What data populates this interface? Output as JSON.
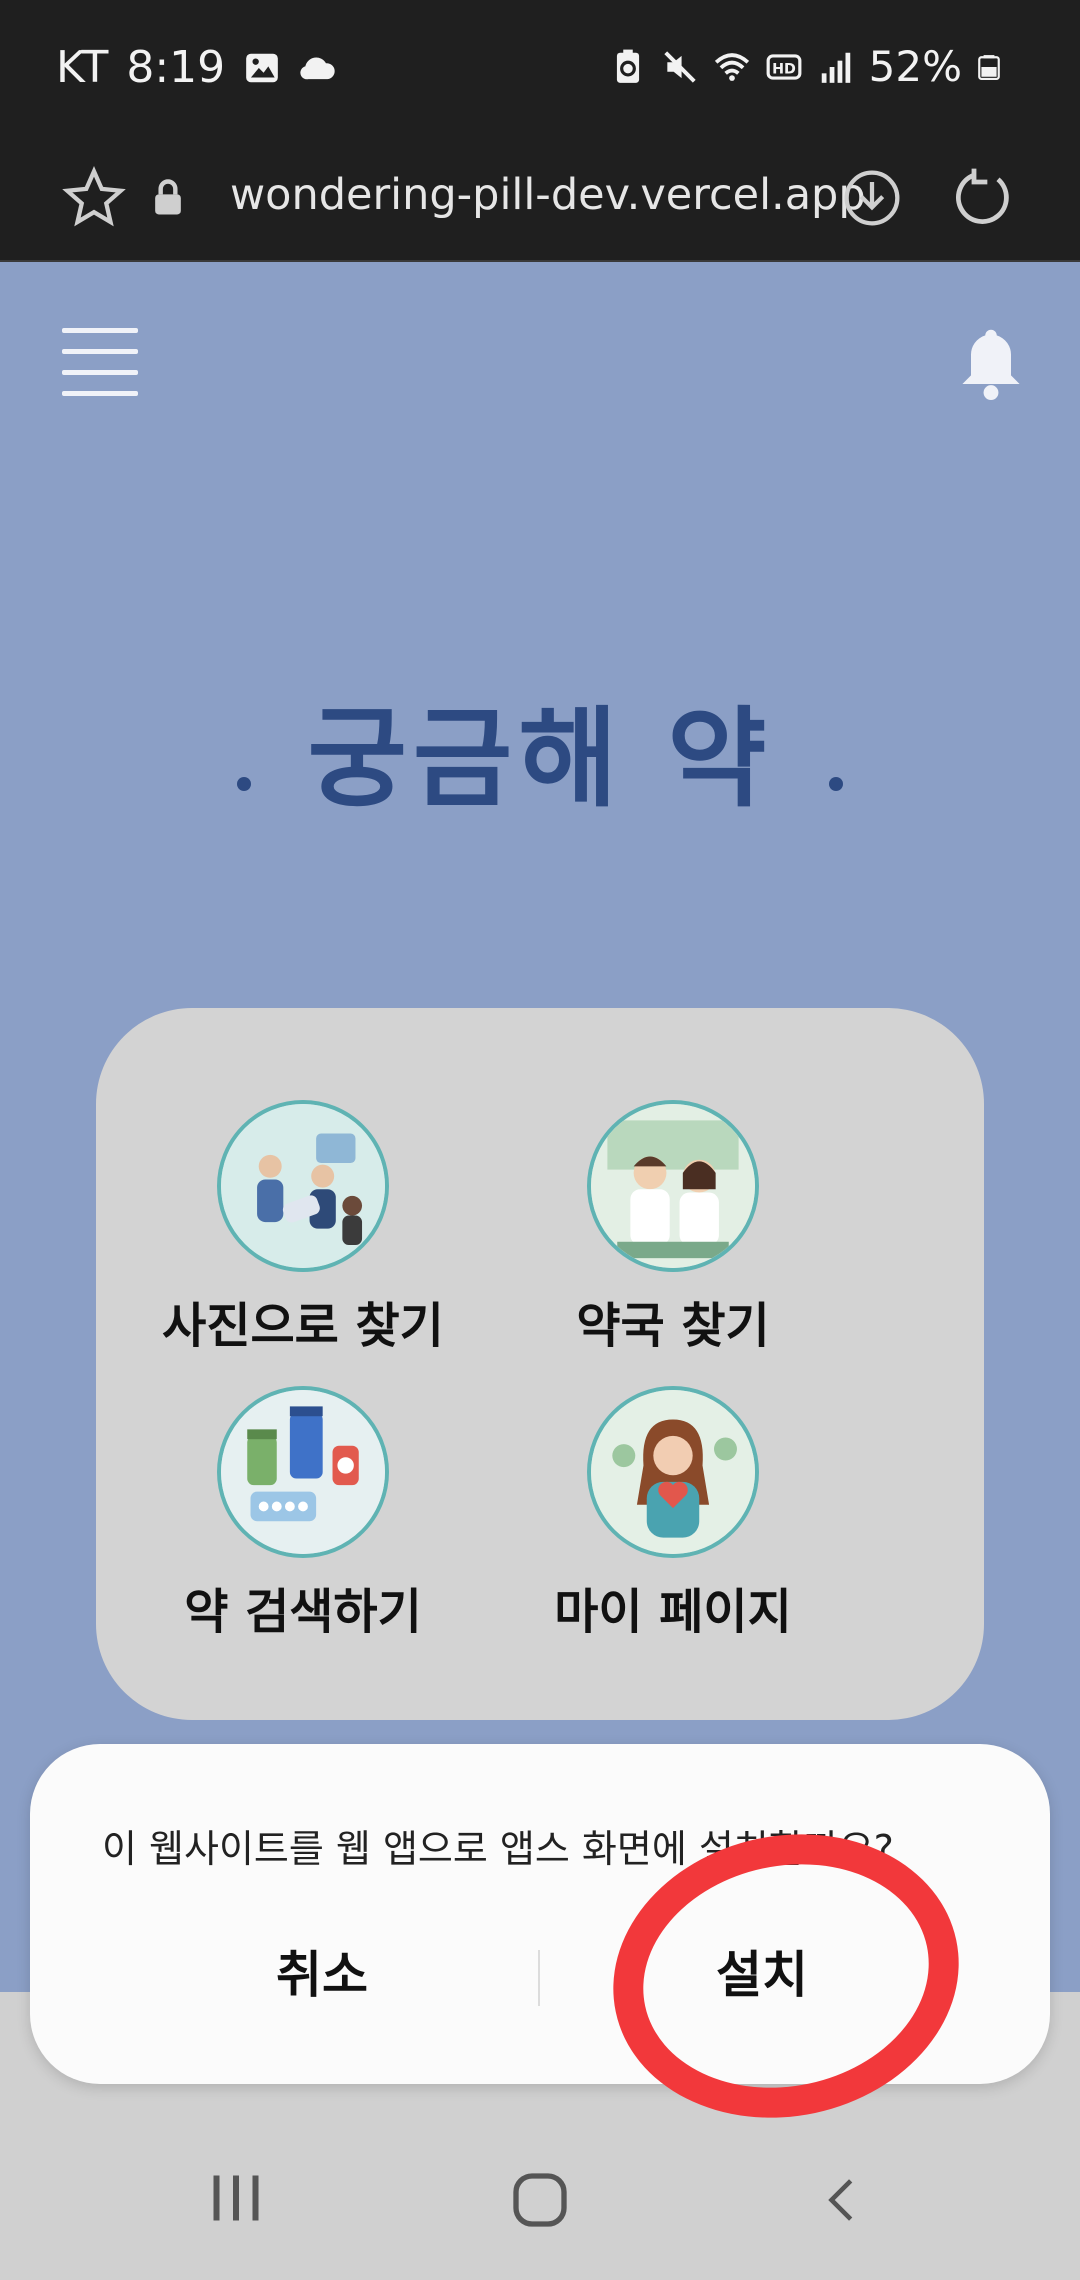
{
  "status_bar": {
    "carrier": "KT",
    "time": "8:19",
    "battery": "52%",
    "left_icons": [
      "image-icon",
      "cloud-icon"
    ],
    "right_icons": [
      "battery-saver-icon",
      "mute-icon",
      "wifi-icon",
      "hd-icon",
      "signal-icon",
      "battery-icon"
    ]
  },
  "browser": {
    "url": "wondering-pill-dev.vercel.app",
    "icons": [
      "star-icon",
      "lock-icon",
      "download-icon",
      "reload-icon"
    ]
  },
  "header": {
    "icons": [
      "hamburger-menu-icon",
      "bell-icon"
    ]
  },
  "logo": {
    "title": "궁금해 약"
  },
  "menu": {
    "items": [
      {
        "label": "사진으로 찾기",
        "icon": "people-with-pills-illustration"
      },
      {
        "label": "약국 찾기",
        "icon": "pharmacists-illustration"
      },
      {
        "label": "약 검색하기",
        "icon": "medicine-bottles-illustration"
      },
      {
        "label": "마이 페이지",
        "icon": "woman-heart-illustration"
      }
    ]
  },
  "dialog": {
    "message": "이 웹사이트를 웹 앱으로 앱스 화면에 설치할까요?",
    "cancel_label": "취소",
    "install_label": "설치"
  },
  "colors": {
    "page_bg": "#8b9fc6",
    "logo": "#2d4a82",
    "card_bg": "#d3d3d3",
    "annotation": "#f2383b"
  },
  "nav_bar": {
    "icons": [
      "recent-apps-icon",
      "home-icon",
      "back-icon"
    ]
  }
}
